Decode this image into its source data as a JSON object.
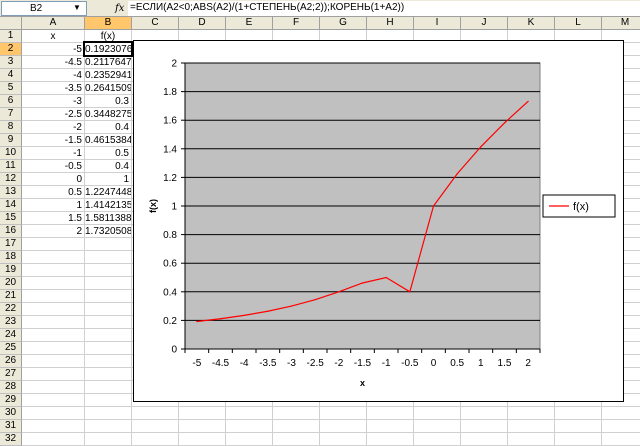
{
  "formula_bar": {
    "name_box": "B2",
    "fx_icon": "fx-icon",
    "formula": "=ЕСЛИ(A2<0;ABS(A2)/(1+СТЕПЕНЬ(A2;2));КОРЕНЬ(1+A2))"
  },
  "sheet": {
    "columns": [
      "A",
      "B",
      "C",
      "D",
      "E",
      "F",
      "G",
      "H",
      "I",
      "J",
      "K",
      "L",
      "M"
    ],
    "rows": [
      "1",
      "2",
      "3",
      "4",
      "5",
      "6",
      "7",
      "8",
      "9",
      "10",
      "11",
      "12",
      "13",
      "14",
      "15",
      "16",
      "17",
      "18",
      "19",
      "20",
      "21",
      "22",
      "23",
      "24",
      "25",
      "26",
      "27",
      "28",
      "29",
      "30",
      "31",
      "32"
    ],
    "headers": {
      "a": "x",
      "b": "f(x)"
    },
    "data": [
      {
        "x": "-5",
        "fx": "0.192307692"
      },
      {
        "x": "-4.5",
        "fx": "0.211764706"
      },
      {
        "x": "-4",
        "fx": "0.235294118"
      },
      {
        "x": "-3.5",
        "fx": "0.264150943"
      },
      {
        "x": "-3",
        "fx": "0.3"
      },
      {
        "x": "-2.5",
        "fx": "0.344827586"
      },
      {
        "x": "-2",
        "fx": "0.4"
      },
      {
        "x": "-1.5",
        "fx": "0.461538462"
      },
      {
        "x": "-1",
        "fx": "0.5"
      },
      {
        "x": "-0.5",
        "fx": "0.4"
      },
      {
        "x": "0",
        "fx": "1"
      },
      {
        "x": "0.5",
        "fx": "1.224744871"
      },
      {
        "x": "1",
        "fx": "1.414213562"
      },
      {
        "x": "1.5",
        "fx": "1.58113883"
      },
      {
        "x": "2",
        "fx": "1.732050808"
      }
    ]
  },
  "chart_data": {
    "type": "line",
    "title": "",
    "xlabel": "x",
    "ylabel": "f(x)",
    "categories": [
      "-5",
      "-4.5",
      "-4",
      "-3.5",
      "-3",
      "-2.5",
      "-2",
      "-1.5",
      "-1",
      "-0.5",
      "0",
      "0.5",
      "1",
      "1.5",
      "2"
    ],
    "series": [
      {
        "name": "f(x)",
        "color": "#ff0000",
        "values": [
          0.192307692,
          0.211764706,
          0.235294118,
          0.264150943,
          0.3,
          0.344827586,
          0.4,
          0.461538462,
          0.5,
          0.4,
          1,
          1.224744871,
          1.414213562,
          1.58113883,
          1.732050808
        ]
      }
    ],
    "ylim": [
      0,
      2
    ],
    "yticks": [
      "0",
      "0.2",
      "0.4",
      "0.6",
      "0.8",
      "1",
      "1.2",
      "1.4",
      "1.6",
      "1.8",
      "2"
    ],
    "plot_area_color": "#c0c0c0",
    "grid": true,
    "legend": "right"
  }
}
